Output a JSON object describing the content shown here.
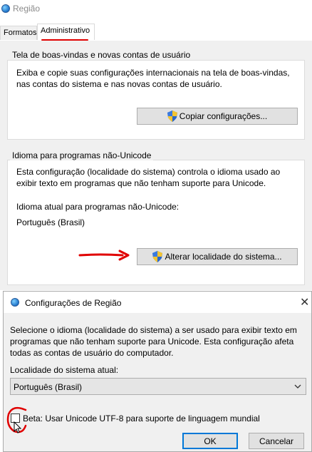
{
  "window": {
    "title": "Região",
    "icon": "globe-icon"
  },
  "tabs": [
    {
      "label": "Formatos"
    },
    {
      "label": "Administrativo"
    }
  ],
  "welcome_group": {
    "title": "Tela de boas-vindas e novas contas de usuário",
    "description_line1": "Exiba e copie suas configurações internacionais na tela de boas-vindas,",
    "description_line2": "nas contas do sistema e nas novas contas de usuário.",
    "button_label": "Copiar configurações..."
  },
  "nonunicode_group": {
    "title": "Idioma para programas não-Unicode",
    "description_line1": "Esta configuração (localidade do sistema) controla o idioma usado ao",
    "description_line2": "exibir texto em programas que não tenham suporte para Unicode.",
    "current_label": "Idioma atual para programas não-Unicode:",
    "current_value": "Português (Brasil)",
    "button_label": "Alterar localidade do sistema..."
  },
  "dialog": {
    "title": "Configurações de Região",
    "description_line1": "Selecione o idioma (localidade do sistema) a ser usado para exibir texto em",
    "description_line2": "programas que não tenham suporte para Unicode. Esta configuração afeta",
    "description_line3": "todas as contas de usuário do computador.",
    "locale_label": "Localidade do sistema atual:",
    "locale_selected": "Português (Brasil)",
    "checkbox_label": "Beta: Usar Unicode UTF-8 para suporte de linguagem mundial",
    "checkbox_checked": false,
    "ok_label": "OK",
    "cancel_label": "Cancelar",
    "close_glyph": "✕"
  },
  "colors": {
    "annotation_red": "#e00000",
    "window_bg": "#f0f0f0",
    "button_bg": "#e1e1e1"
  }
}
